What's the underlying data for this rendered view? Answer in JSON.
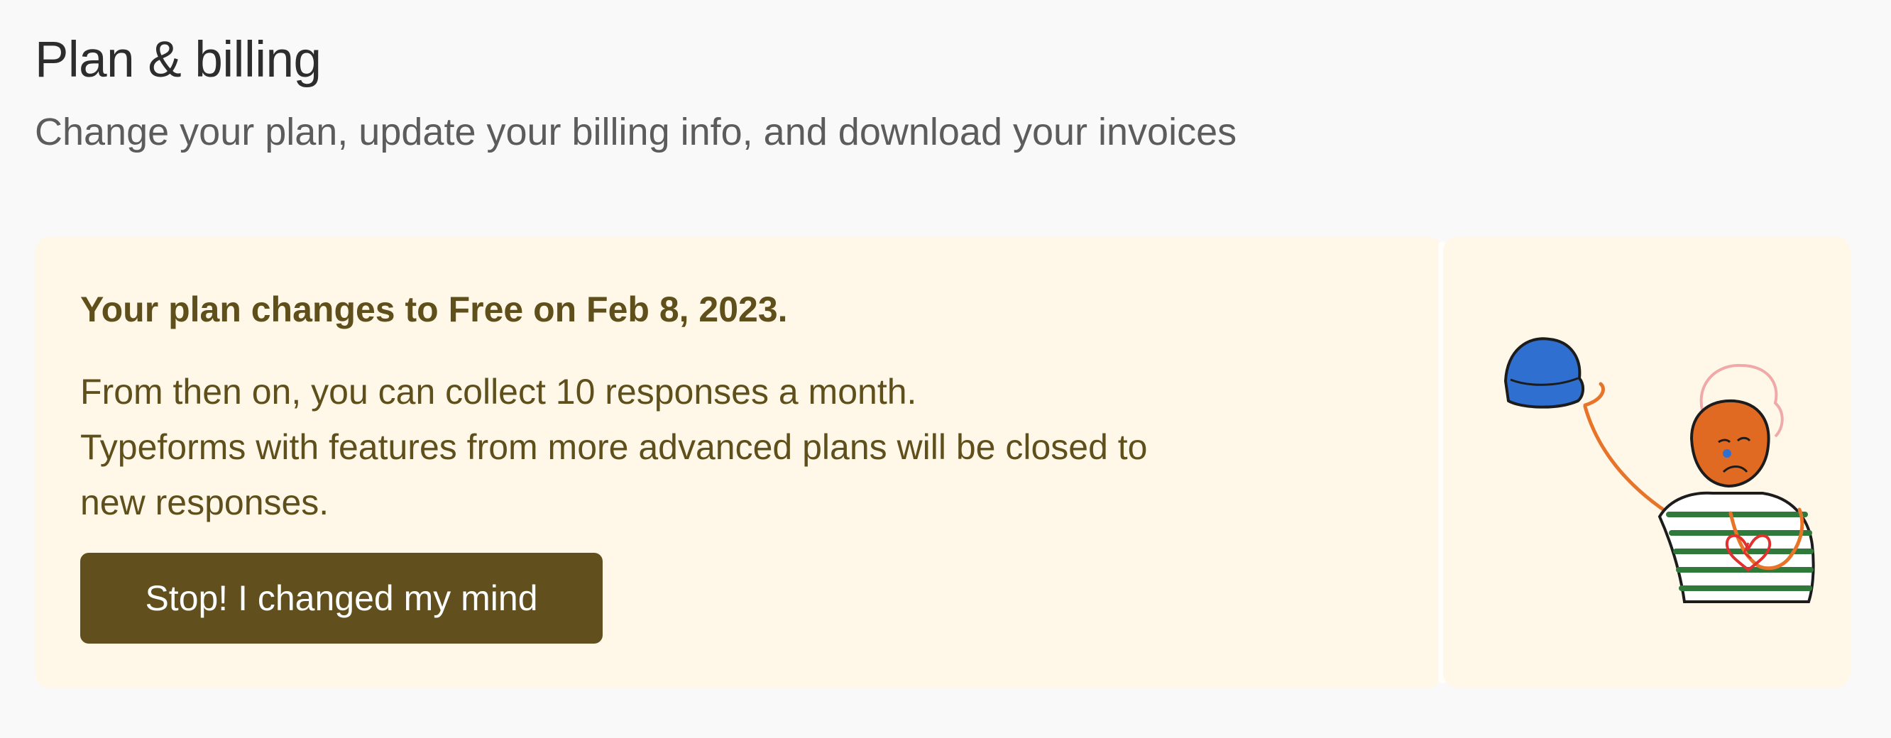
{
  "header": {
    "title": "Plan & billing",
    "subtitle": "Change your plan, update your billing info, and download your invoices"
  },
  "notice": {
    "heading": "Your plan changes to Free on Feb 8, 2023.",
    "body_lines": [
      "From then on, you can collect 10 responses a month.",
      "Typeforms with features from more advanced plans will be closed to",
      "new responses."
    ],
    "button_label": "Stop! I changed my mind"
  },
  "colors": {
    "page_background": "#f9f9f9",
    "card_background": "#fff8e9",
    "accent": "#614f1d",
    "notice_text": "#5f4f1b"
  },
  "illustration": {
    "icon": "sad-person-waving-hat-illustration"
  }
}
